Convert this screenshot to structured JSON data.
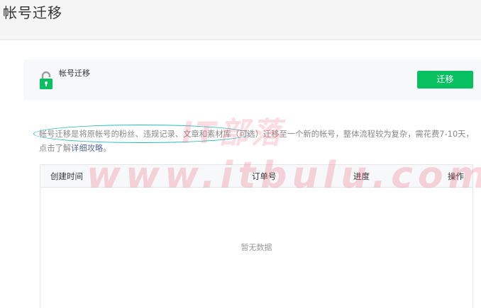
{
  "page": {
    "title": "帐号迁移"
  },
  "panel": {
    "title": "帐号迁移",
    "migrate_button": "迁移"
  },
  "description": {
    "text": "帐号迁移是将原帐号的粉丝、违规记录、文章和素材库（可选）迁移至一个新的帐号，整体流程较为复杂，需花费7-10天，点击了解",
    "link": "详细攻略",
    "suffix": "。"
  },
  "table": {
    "columns": [
      "创建时间",
      "订单号",
      "进度",
      "操作"
    ],
    "empty_text": "暂无数据"
  },
  "watermark": {
    "line1": "IT部落",
    "line2": "www.itbulu.com"
  },
  "colors": {
    "accent": "#07c160",
    "link": "#576b95",
    "highlight": "#28b8b8",
    "watermark": "#f05a78"
  },
  "icons": {
    "lock": "lock-icon"
  }
}
